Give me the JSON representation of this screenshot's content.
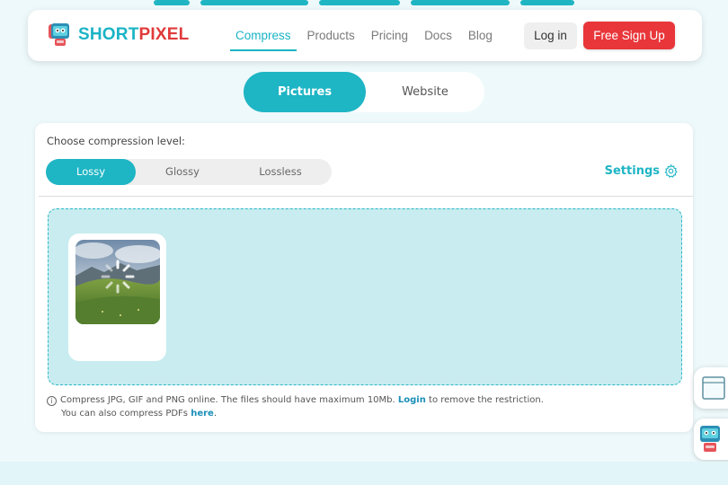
{
  "brand": {
    "name_part1": "SHORT",
    "name_part2": "PIXEL",
    "accent_color": "#1eb5c4",
    "signup_color": "#e8363a"
  },
  "nav": {
    "links": [
      "Compress",
      "Products",
      "Pricing",
      "Docs",
      "Blog"
    ],
    "active": "Compress",
    "login_label": "Log in",
    "signup_label": "Free Sign Up"
  },
  "mode_toggle": {
    "pictures_label": "Pictures",
    "website_label": "Website",
    "selected": "Pictures"
  },
  "compression": {
    "label": "Choose compression level:",
    "levels": [
      "Lossy",
      "Glossy",
      "Lossless"
    ],
    "selected": "Lossy",
    "settings_label": "Settings"
  },
  "upload": {
    "status": "loading",
    "icons": [
      "landscape-thumbnail",
      "loading-spinner-icon"
    ]
  },
  "info": {
    "line1_text": "Compress JPG, GIF and PNG online. The files should have maximum 10Mb.",
    "login_link": "Login",
    "line1_suffix": "to remove the restriction.",
    "line2_text": "You can also compress PDFs",
    "here_link": "here",
    "line2_suffix": "."
  },
  "side_widgets": [
    "document-icon",
    "robot-chat-icon"
  ]
}
